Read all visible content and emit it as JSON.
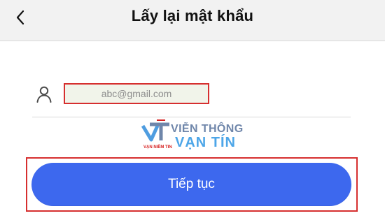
{
  "header": {
    "title": "Lấy lại mật khẩu",
    "back_icon": "chevron-left-icon"
  },
  "form": {
    "user_icon": "user-icon",
    "email_value": "abc@gmail.com"
  },
  "watermark": {
    "line1": "VIỄN THÔNG",
    "line2": "VẠN TÍN",
    "small_text": "VẠN NIỀM TIN"
  },
  "actions": {
    "continue_label": "Tiếp tục"
  },
  "colors": {
    "primary_button": "#3d68ee",
    "highlight_red": "#d62f2f",
    "header_background": "#f2f2f2"
  }
}
